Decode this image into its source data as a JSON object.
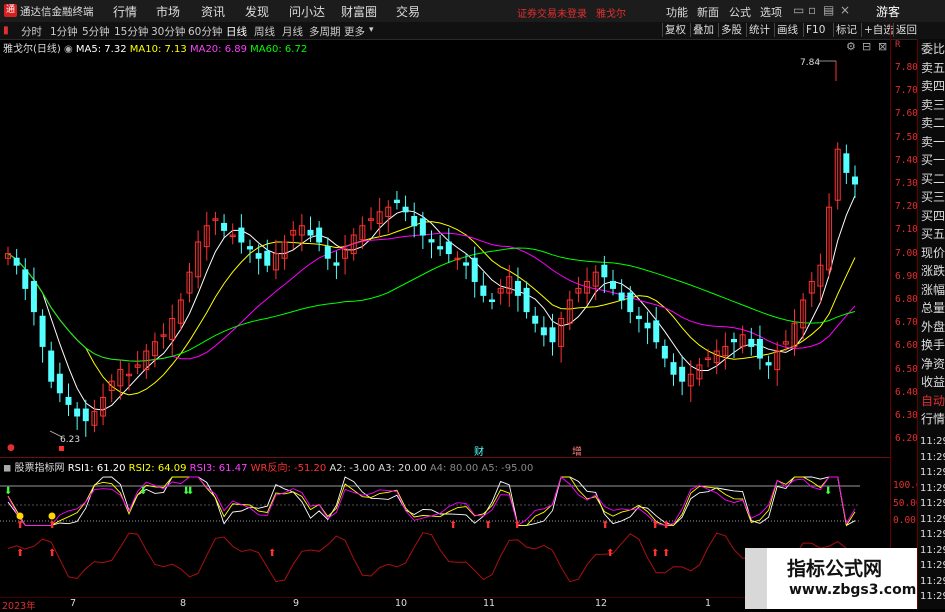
{
  "app_title": "通达信金融终端",
  "menu": [
    "行情",
    "市场",
    "资讯",
    "发现",
    "问小达",
    "财富圈",
    "交易"
  ],
  "login_notice": "证券交易未登录",
  "stock_menu_name": "雅戈尔",
  "menu_right": [
    "功能",
    "新面",
    "公式",
    "选项"
  ],
  "guest": "游客",
  "periods": [
    "分时",
    "1分钟",
    "5分钟",
    "15分钟",
    "30分钟",
    "60分钟",
    "日线",
    "周线",
    "月线",
    "多周期",
    "更多"
  ],
  "toolbar": [
    "复权",
    "叠加",
    "多股",
    "统计",
    "画线",
    "F10",
    "标记",
    "+自选",
    "返回"
  ],
  "main_legend": {
    "stock": "雅戈尔(日线)",
    "ma5": "MA5: 7.32",
    "ma10": "MA10: 7.13",
    "ma20": "MA20: 6.89",
    "ma60": "MA60: 6.72"
  },
  "high_label": "7.84",
  "low_label": "6.23",
  "price_ticks": [
    "7.80",
    "7.70",
    "7.60",
    "7.50",
    "7.40",
    "7.30",
    "7.20",
    "7.10",
    "7.00",
    "6.90",
    "6.80",
    "6.70",
    "6.60",
    "6.50",
    "6.40",
    "6.30",
    "6.20"
  ],
  "top_corner": "R",
  "event_markers": [
    "财",
    "增"
  ],
  "indicator_legend": {
    "name": "股票指标网",
    "rsi1": "RSI1: 61.20",
    "rsi2": "RSI2: 64.09",
    "rsi3": "RSI3: 61.47",
    "wr": "WR反向: -51.20",
    "a2": "A2: -3.00",
    "a3": "A3: 20.00",
    "a4": "A4: 80.00",
    "a5": "A5: -95.00"
  },
  "indicator_ticks": [
    "100.0",
    "50.00",
    "0.00"
  ],
  "time_axis": [
    "2023年",
    "7",
    "8",
    "9",
    "10",
    "11",
    "12",
    "1"
  ],
  "right_panel": [
    "委比",
    "卖五",
    "卖四",
    "卖三",
    "卖二",
    "卖一",
    "买一",
    "买二",
    "买三",
    "买四",
    "买五",
    "现价",
    "涨跌",
    "涨幅",
    "总量",
    "外盘",
    "换手",
    "净资",
    "收益",
    "自动",
    "行情"
  ],
  "right_times": [
    "11:29",
    "11:29",
    "11:29",
    "11:29",
    "11:29",
    "11:29",
    "11:29",
    "11:29",
    "11:29",
    "11:29",
    "11:29"
  ],
  "watermark": {
    "title": "指标公式网",
    "url": "www.zbgs3.com"
  },
  "colors": {
    "up": "#ff3232",
    "down": "#54ffff",
    "ma5": "#ffffff",
    "ma10": "#ffff00",
    "ma20": "#ff00ff",
    "ma60": "#00ff00"
  },
  "chart_data": {
    "type": "candlestick",
    "price_range": [
      6.2,
      7.85
    ],
    "close_series": [
      7.0,
      6.95,
      6.85,
      6.75,
      6.6,
      6.45,
      6.4,
      6.35,
      6.3,
      6.28,
      6.32,
      6.38,
      6.45,
      6.5,
      6.48,
      6.52,
      6.58,
      6.62,
      6.65,
      6.72,
      6.8,
      6.92,
      7.05,
      7.12,
      7.15,
      7.1,
      7.08,
      7.05,
      7.02,
      6.98,
      6.95,
      7.0,
      7.05,
      7.1,
      7.12,
      7.08,
      7.05,
      6.98,
      6.95,
      7.02,
      7.08,
      7.12,
      7.15,
      7.18,
      7.2,
      7.22,
      7.18,
      7.12,
      7.08,
      7.05,
      7.02,
      7.0,
      6.98,
      6.95,
      6.88,
      6.82,
      6.8,
      6.85,
      6.9,
      6.82,
      6.75,
      6.7,
      6.65,
      6.62,
      6.72,
      6.8,
      6.85,
      6.88,
      6.92,
      6.9,
      6.85,
      6.8,
      6.75,
      6.72,
      6.68,
      6.62,
      6.55,
      6.48,
      6.45,
      6.48,
      6.52,
      6.55,
      6.58,
      6.6,
      6.62,
      6.65,
      6.6,
      6.55,
      6.52,
      6.58,
      6.62,
      6.7,
      6.8,
      6.88,
      6.95,
      7.2,
      7.45,
      7.35,
      7.3
    ]
  }
}
